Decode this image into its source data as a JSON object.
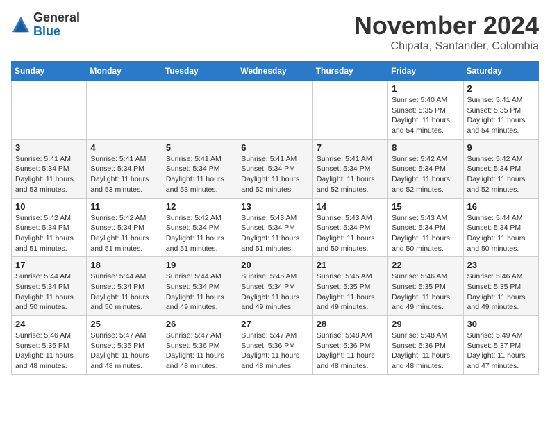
{
  "header": {
    "logo_general": "General",
    "logo_blue": "Blue",
    "month_title": "November 2024",
    "location": "Chipata, Santander, Colombia"
  },
  "calendar": {
    "days_of_week": [
      "Sunday",
      "Monday",
      "Tuesday",
      "Wednesday",
      "Thursday",
      "Friday",
      "Saturday"
    ],
    "weeks": [
      [
        {
          "day": "",
          "info": ""
        },
        {
          "day": "",
          "info": ""
        },
        {
          "day": "",
          "info": ""
        },
        {
          "day": "",
          "info": ""
        },
        {
          "day": "",
          "info": ""
        },
        {
          "day": "1",
          "info": "Sunrise: 5:40 AM\nSunset: 5:35 PM\nDaylight: 11 hours and 54 minutes."
        },
        {
          "day": "2",
          "info": "Sunrise: 5:41 AM\nSunset: 5:35 PM\nDaylight: 11 hours and 54 minutes."
        }
      ],
      [
        {
          "day": "3",
          "info": "Sunrise: 5:41 AM\nSunset: 5:34 PM\nDaylight: 11 hours and 53 minutes."
        },
        {
          "day": "4",
          "info": "Sunrise: 5:41 AM\nSunset: 5:34 PM\nDaylight: 11 hours and 53 minutes."
        },
        {
          "day": "5",
          "info": "Sunrise: 5:41 AM\nSunset: 5:34 PM\nDaylight: 11 hours and 53 minutes."
        },
        {
          "day": "6",
          "info": "Sunrise: 5:41 AM\nSunset: 5:34 PM\nDaylight: 11 hours and 52 minutes."
        },
        {
          "day": "7",
          "info": "Sunrise: 5:41 AM\nSunset: 5:34 PM\nDaylight: 11 hours and 52 minutes."
        },
        {
          "day": "8",
          "info": "Sunrise: 5:42 AM\nSunset: 5:34 PM\nDaylight: 11 hours and 52 minutes."
        },
        {
          "day": "9",
          "info": "Sunrise: 5:42 AM\nSunset: 5:34 PM\nDaylight: 11 hours and 52 minutes."
        }
      ],
      [
        {
          "day": "10",
          "info": "Sunrise: 5:42 AM\nSunset: 5:34 PM\nDaylight: 11 hours and 51 minutes."
        },
        {
          "day": "11",
          "info": "Sunrise: 5:42 AM\nSunset: 5:34 PM\nDaylight: 11 hours and 51 minutes."
        },
        {
          "day": "12",
          "info": "Sunrise: 5:42 AM\nSunset: 5:34 PM\nDaylight: 11 hours and 51 minutes."
        },
        {
          "day": "13",
          "info": "Sunrise: 5:43 AM\nSunset: 5:34 PM\nDaylight: 11 hours and 51 minutes."
        },
        {
          "day": "14",
          "info": "Sunrise: 5:43 AM\nSunset: 5:34 PM\nDaylight: 11 hours and 50 minutes."
        },
        {
          "day": "15",
          "info": "Sunrise: 5:43 AM\nSunset: 5:34 PM\nDaylight: 11 hours and 50 minutes."
        },
        {
          "day": "16",
          "info": "Sunrise: 5:44 AM\nSunset: 5:34 PM\nDaylight: 11 hours and 50 minutes."
        }
      ],
      [
        {
          "day": "17",
          "info": "Sunrise: 5:44 AM\nSunset: 5:34 PM\nDaylight: 11 hours and 50 minutes."
        },
        {
          "day": "18",
          "info": "Sunrise: 5:44 AM\nSunset: 5:34 PM\nDaylight: 11 hours and 50 minutes."
        },
        {
          "day": "19",
          "info": "Sunrise: 5:44 AM\nSunset: 5:34 PM\nDaylight: 11 hours and 49 minutes."
        },
        {
          "day": "20",
          "info": "Sunrise: 5:45 AM\nSunset: 5:34 PM\nDaylight: 11 hours and 49 minutes."
        },
        {
          "day": "21",
          "info": "Sunrise: 5:45 AM\nSunset: 5:35 PM\nDaylight: 11 hours and 49 minutes."
        },
        {
          "day": "22",
          "info": "Sunrise: 5:46 AM\nSunset: 5:35 PM\nDaylight: 11 hours and 49 minutes."
        },
        {
          "day": "23",
          "info": "Sunrise: 5:46 AM\nSunset: 5:35 PM\nDaylight: 11 hours and 49 minutes."
        }
      ],
      [
        {
          "day": "24",
          "info": "Sunrise: 5:46 AM\nSunset: 5:35 PM\nDaylight: 11 hours and 48 minutes."
        },
        {
          "day": "25",
          "info": "Sunrise: 5:47 AM\nSunset: 5:35 PM\nDaylight: 11 hours and 48 minutes."
        },
        {
          "day": "26",
          "info": "Sunrise: 5:47 AM\nSunset: 5:36 PM\nDaylight: 11 hours and 48 minutes."
        },
        {
          "day": "27",
          "info": "Sunrise: 5:47 AM\nSunset: 5:36 PM\nDaylight: 11 hours and 48 minutes."
        },
        {
          "day": "28",
          "info": "Sunrise: 5:48 AM\nSunset: 5:36 PM\nDaylight: 11 hours and 48 minutes."
        },
        {
          "day": "29",
          "info": "Sunrise: 5:48 AM\nSunset: 5:36 PM\nDaylight: 11 hours and 48 minutes."
        },
        {
          "day": "30",
          "info": "Sunrise: 5:49 AM\nSunset: 5:37 PM\nDaylight: 11 hours and 47 minutes."
        }
      ]
    ]
  }
}
